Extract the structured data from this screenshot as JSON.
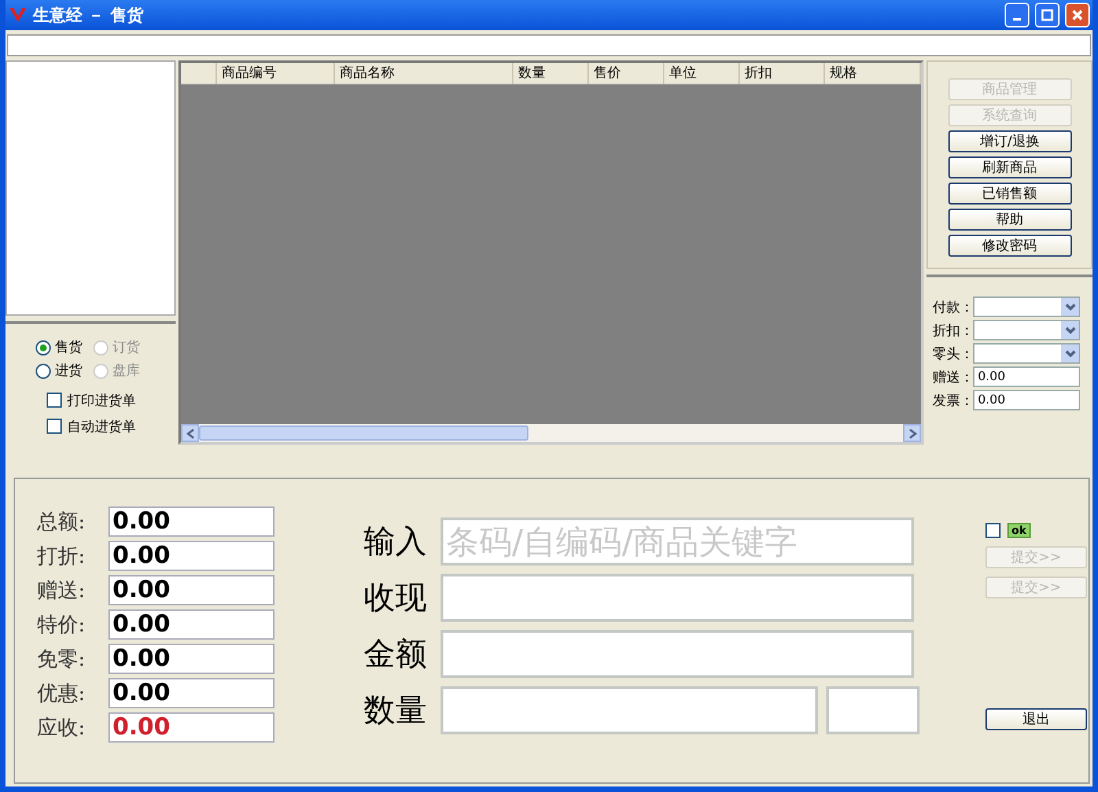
{
  "window": {
    "title": "生意经 － 售货"
  },
  "grid": {
    "columns": [
      "商品编号",
      "商品名称",
      "数量",
      "售价",
      "单位",
      "折扣",
      "规格"
    ]
  },
  "mode_options": [
    {
      "label": "售货",
      "selected": true,
      "disabled": false
    },
    {
      "label": "订货",
      "selected": false,
      "disabled": true
    },
    {
      "label": "进货",
      "selected": false,
      "disabled": false
    },
    {
      "label": "盘库",
      "selected": false,
      "disabled": true
    }
  ],
  "checkboxes": [
    {
      "label": "打印进货单",
      "checked": false
    },
    {
      "label": "自动进货单",
      "checked": false
    }
  ],
  "menu_buttons": [
    {
      "label": "商品管理",
      "disabled": true
    },
    {
      "label": "系统查询",
      "disabled": true
    },
    {
      "label": "增订/退换",
      "disabled": false
    },
    {
      "label": "刷新商品",
      "disabled": false
    },
    {
      "label": "已销售额",
      "disabled": false
    },
    {
      "label": "帮助",
      "disabled": false
    },
    {
      "label": "修改密码",
      "disabled": false
    }
  ],
  "payment_fields": [
    {
      "label": "付款：",
      "kind": "dropdown"
    },
    {
      "label": "折扣：",
      "kind": "dropdown"
    },
    {
      "label": "零头：",
      "kind": "dropdown"
    },
    {
      "label": "赠送：",
      "kind": "text",
      "value": "0.00"
    },
    {
      "label": "发票：",
      "kind": "text",
      "value": "0.00"
    }
  ],
  "totals": [
    {
      "label": "总额:",
      "value": "0.00",
      "highlight": false
    },
    {
      "label": "打折:",
      "value": "0.00",
      "highlight": false
    },
    {
      "label": "赠送:",
      "value": "0.00",
      "highlight": false
    },
    {
      "label": "特价:",
      "value": "0.00",
      "highlight": false
    },
    {
      "label": "免零:",
      "value": "0.00",
      "highlight": false
    },
    {
      "label": "优惠:",
      "value": "0.00",
      "highlight": false
    },
    {
      "label": "应收:",
      "value": "0.00",
      "highlight": true
    }
  ],
  "entry_fields": [
    {
      "label": "输入",
      "placeholder": "条码/自编码/商品关键字",
      "split": false
    },
    {
      "label": "收现",
      "split": false
    },
    {
      "label": "金额",
      "split": false
    },
    {
      "label": "数量",
      "split": true
    }
  ],
  "ok_toggle": {
    "checked": false,
    "label": "ok"
  },
  "submit_buttons": [
    {
      "label": "提交>>",
      "disabled": true
    },
    {
      "label": "提交>>",
      "disabled": true
    }
  ],
  "exit_button": {
    "label": "退出"
  }
}
